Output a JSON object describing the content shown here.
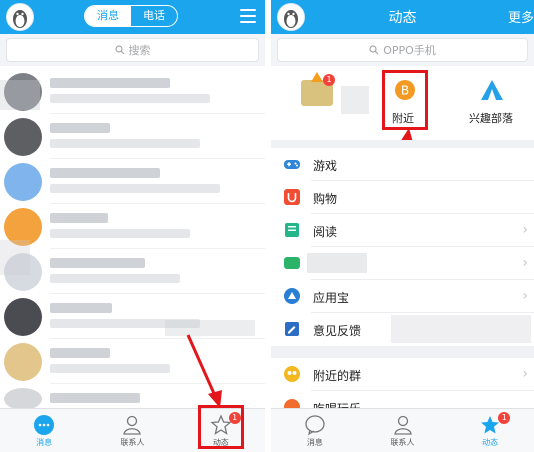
{
  "left_screen": {
    "segment": {
      "messages": "消息",
      "phone": "电话"
    },
    "search_placeholder": "搜索",
    "tabs": [
      {
        "label": "消息",
        "active": true
      },
      {
        "label": "联系人",
        "active": false
      },
      {
        "label": "动态",
        "active": false,
        "badge": "1"
      }
    ]
  },
  "right_screen": {
    "title": "动态",
    "more": "更多",
    "search_placeholder": "OPPO手机",
    "features": [
      {
        "label": "",
        "badge": "1"
      },
      {
        "label": "附近",
        "coin_text": "B"
      },
      {
        "label": "兴趣部落"
      }
    ],
    "rows": [
      {
        "label": "游戏",
        "icon": "gamepad-icon"
      },
      {
        "label": "购物",
        "icon": "shopping-bag-icon"
      },
      {
        "label": "阅读",
        "icon": "book-icon"
      },
      {
        "label": "",
        "icon": "green-app-icon"
      },
      {
        "label": "应用宝",
        "icon": "app-store-icon"
      },
      {
        "label": "意见反馈",
        "icon": "feedback-icon"
      },
      {
        "label": "附近的群",
        "icon": "nearby-group-icon"
      },
      {
        "label": "吃喝玩乐",
        "icon": "food-icon"
      }
    ],
    "tabs": [
      {
        "label": "消息",
        "active": false
      },
      {
        "label": "联系人",
        "active": false
      },
      {
        "label": "动态",
        "active": true,
        "badge": "1"
      }
    ]
  },
  "colors": {
    "brand_blue": "#1aa5ec",
    "highlight_red": "#e3161b",
    "badge_red": "#f2433b"
  }
}
